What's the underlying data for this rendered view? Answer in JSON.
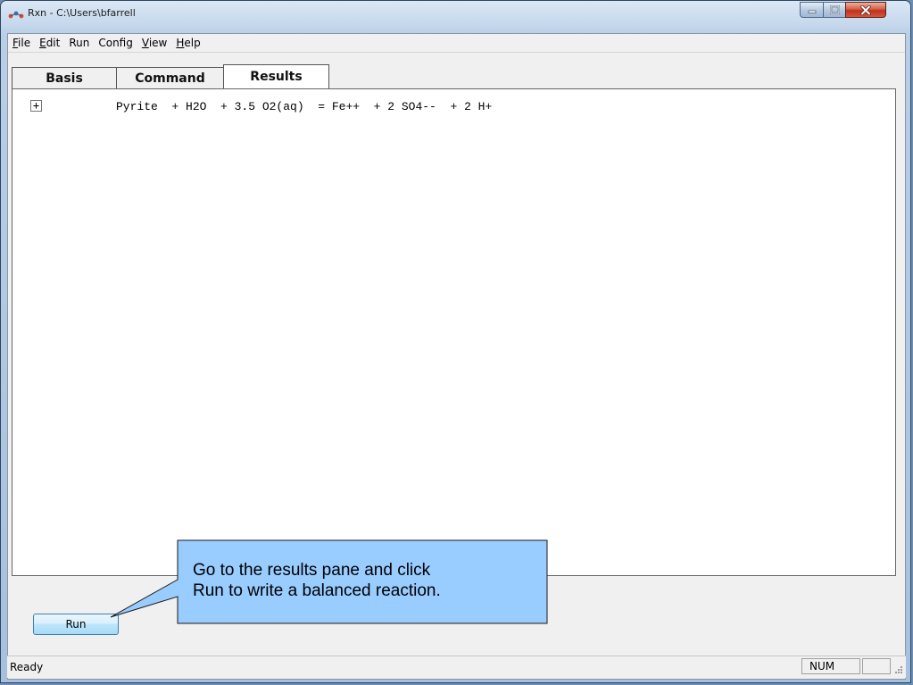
{
  "window": {
    "title": "Rxn - C:\\Users\\bfarrell",
    "icon": "rxn-app-icon",
    "controls": {
      "minimize": "minimize-icon",
      "maximize": "maximize-icon",
      "close": "close-icon"
    }
  },
  "menu": {
    "items": [
      "File",
      "Edit",
      "Run",
      "Config",
      "View",
      "Help"
    ]
  },
  "tabs": {
    "basis": "Basis",
    "command": "Command",
    "results": "Results",
    "active": "Results"
  },
  "results": {
    "expand_symbol": "+",
    "reaction": "Pyrite  + H2O  + 3.5 O2(aq)  = Fe++  + 2 SO4--  + 2 H+"
  },
  "buttons": {
    "run": "Run"
  },
  "callout": {
    "line1": "Go to the results pane and click",
    "line2": "Run to write a balanced reaction.",
    "fill": "#99ccff"
  },
  "status": {
    "text": "Ready",
    "num": "NUM"
  }
}
